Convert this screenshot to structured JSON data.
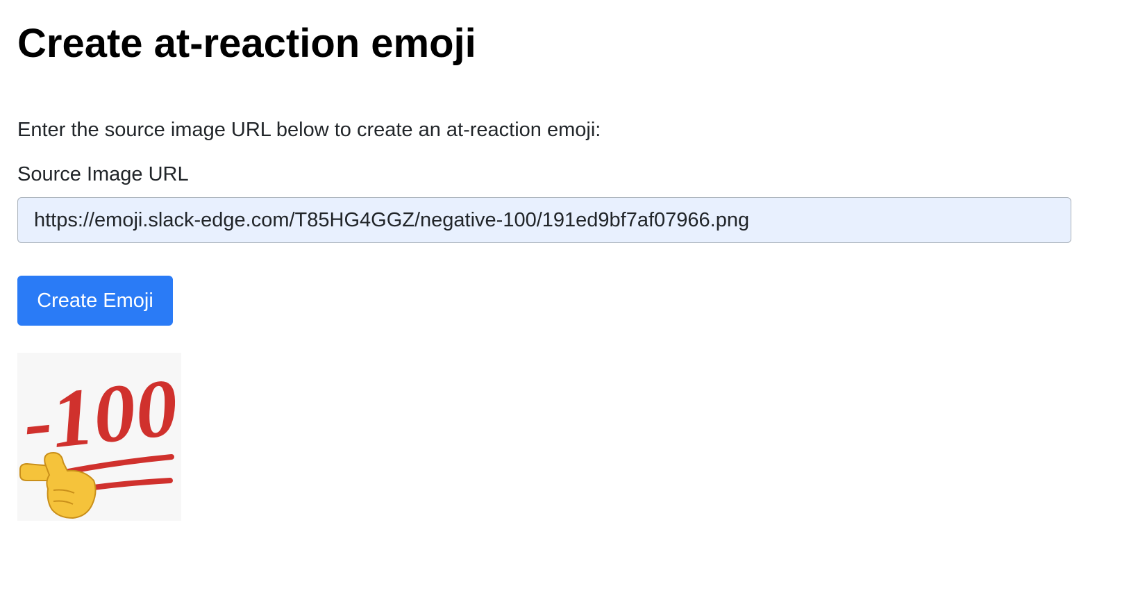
{
  "page": {
    "title": "Create at-reaction emoji",
    "intro": "Enter the source image URL below to create an at-reaction emoji:"
  },
  "form": {
    "source_label": "Source Image URL",
    "source_value": "https://emoji.slack-edge.com/T85HG4GGZ/negative-100/191ed9bf7af07966.png",
    "submit_label": "Create Emoji"
  },
  "preview": {
    "emoji_text": "-100",
    "icon": "pointing-hand-icon",
    "colors": {
      "number": "#d0312d",
      "hand": "#f5c33b",
      "button": "#2a7bf6",
      "input_bg": "#e8f0fe"
    }
  }
}
